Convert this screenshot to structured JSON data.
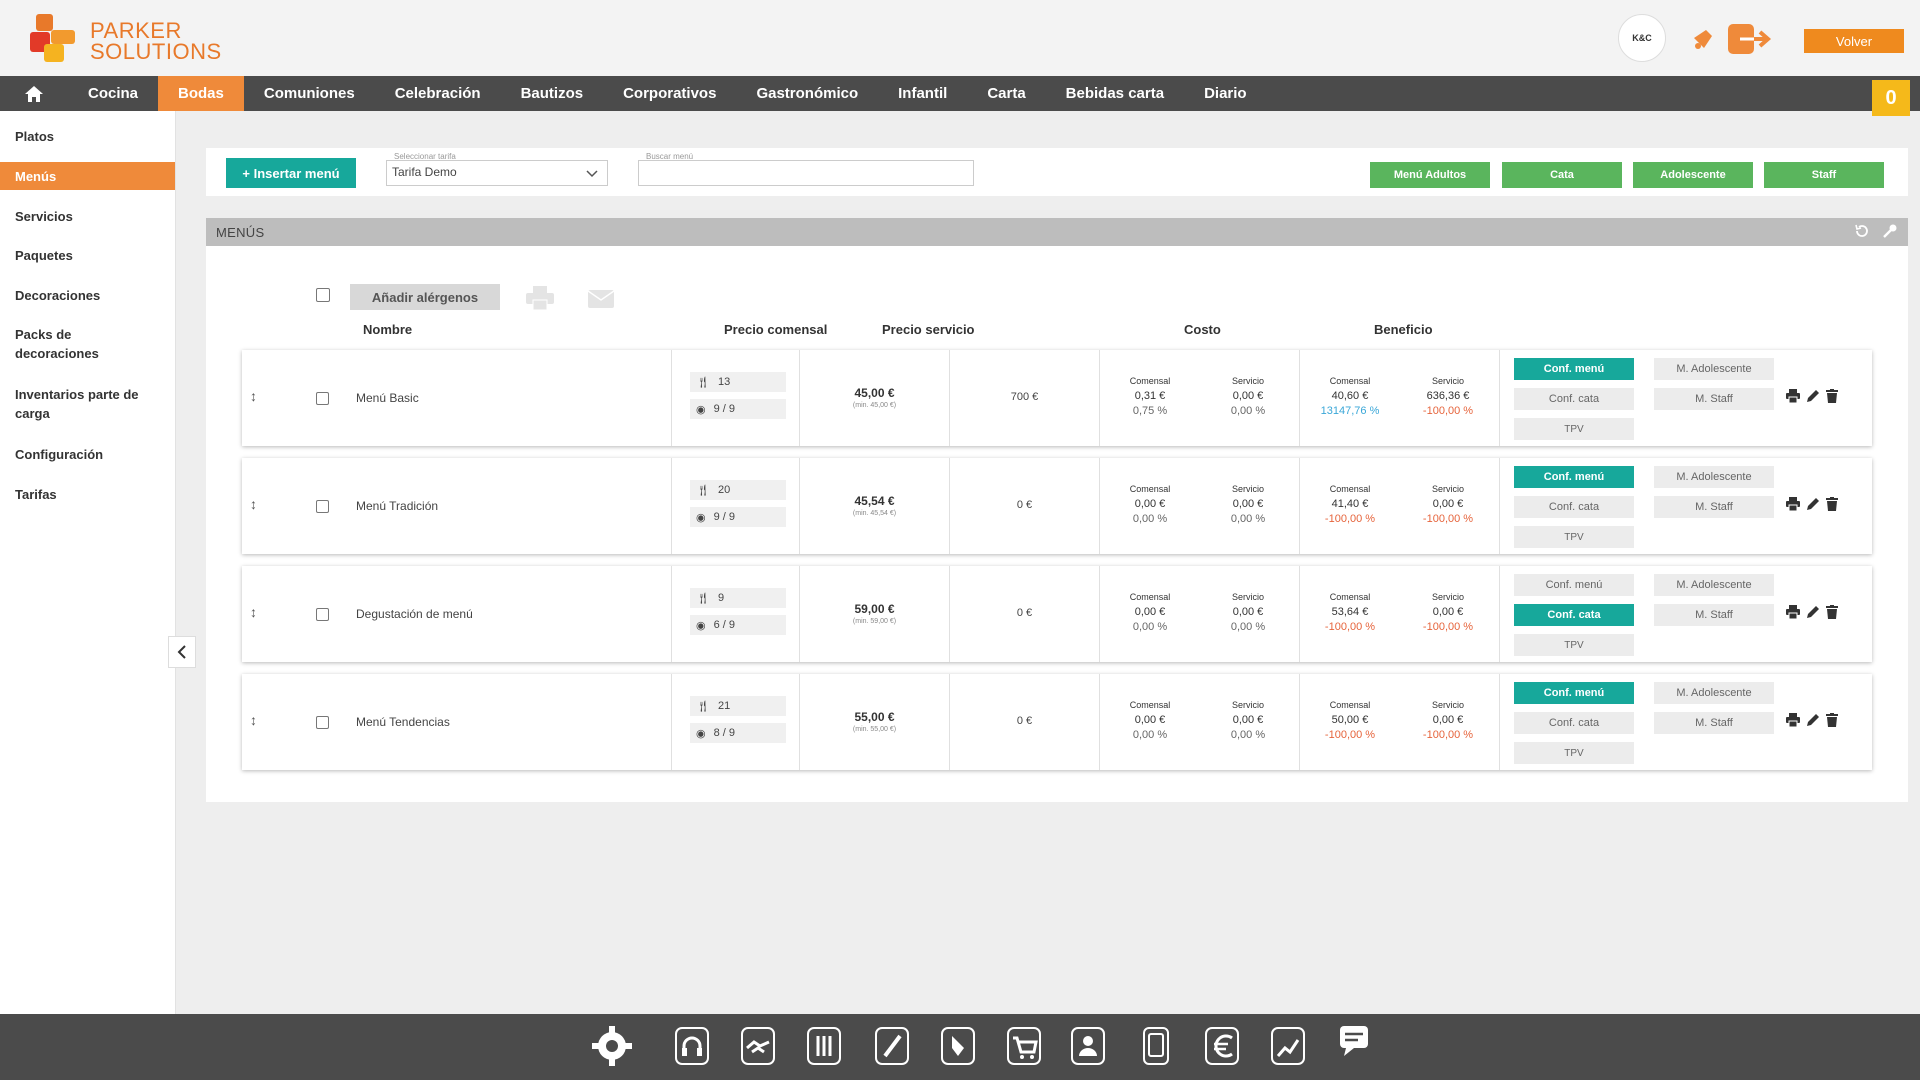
{
  "header": {
    "logo_line1": "PARKER",
    "logo_line2": "SOLUTIONS",
    "avatar_text": "K&C",
    "back_label": "Volver",
    "cart_count": "0"
  },
  "nav": {
    "items": [
      "Cocina",
      "Bodas",
      "Comuniones",
      "Celebración",
      "Bautizos",
      "Corporativos",
      "Gastronómico",
      "Infantil",
      "Carta",
      "Bebidas carta",
      "Diario"
    ],
    "active": "Bodas"
  },
  "sidebar": {
    "items": [
      "Platos",
      "Menús",
      "Servicios",
      "Paquetes",
      "Decoraciones",
      "Packs de decoraciones",
      "Inventarios parte de carga",
      "Configuración",
      "Tarifas"
    ],
    "active": "Menús"
  },
  "toolbar": {
    "insert_label": "+ Insertar menú",
    "tarifa_label": "Seleccionar tarifa",
    "tarifa_value": "Tarifa Demo",
    "search_label": "Buscar menú",
    "search_value": "",
    "filters": [
      "Menú Adultos",
      "Cata",
      "Adolescente",
      "Staff"
    ]
  },
  "panel": {
    "title": "MENÚS",
    "add_allergens_label": "Añadir alérgenos",
    "columns": {
      "name": "Nombre",
      "diner_price": "Precio comensal",
      "service_price": "Precio servicio",
      "cost": "Costo",
      "profit": "Beneficio"
    },
    "sub_labels": {
      "diner": "Comensal",
      "service": "Servicio"
    },
    "action_labels": {
      "conf_menu": "Conf. menú",
      "conf_cata": "Conf. cata",
      "tpv": "TPV",
      "m_adolescente": "M. Adolescente",
      "m_staff": "M. Staff"
    },
    "rows": [
      {
        "name": "Menú Basic",
        "dishes": "13",
        "views": "9 / 9",
        "price": "45,00 €",
        "price_min": "(min. 45,00 €)",
        "service_price": "700 €",
        "cost_diner": "0,31 €",
        "cost_diner_pct": "0,75 %",
        "cost_service": "0,00 €",
        "cost_service_pct": "0,00 %",
        "profit_diner": "40,60 €",
        "profit_diner_pct": "13147,76 %",
        "profit_service": "636,36 €",
        "profit_service_pct": "-100,00 %",
        "active": "menu"
      },
      {
        "name": "Menú Tradición",
        "dishes": "20",
        "views": "9 / 9",
        "price": "45,54 €",
        "price_min": "(min. 45,54 €)",
        "service_price": "0 €",
        "cost_diner": "0,00 €",
        "cost_diner_pct": "0,00 %",
        "cost_service": "0,00 €",
        "cost_service_pct": "0,00 %",
        "profit_diner": "41,40 €",
        "profit_diner_pct": "-100,00 %",
        "profit_service": "0,00 €",
        "profit_service_pct": "-100,00 %",
        "active": "menu"
      },
      {
        "name": "Degustación de menú",
        "dishes": "9",
        "views": "6 / 9",
        "price": "59,00 €",
        "price_min": "(min. 59,00 €)",
        "service_price": "0 €",
        "cost_diner": "0,00 €",
        "cost_diner_pct": "0,00 %",
        "cost_service": "0,00 €",
        "cost_service_pct": "0,00 %",
        "profit_diner": "53,64 €",
        "profit_diner_pct": "-100,00 %",
        "profit_service": "0,00 €",
        "profit_service_pct": "-100,00 %",
        "active": "cata"
      },
      {
        "name": "Menú Tendencias",
        "dishes": "21",
        "views": "8 / 9",
        "price": "55,00 €",
        "price_min": "(min. 55,00 €)",
        "service_price": "0 €",
        "cost_diner": "0,00 €",
        "cost_diner_pct": "0,00 %",
        "cost_service": "0,00 €",
        "cost_service_pct": "0,00 %",
        "profit_diner": "50,00 €",
        "profit_diner_pct": "-100,00 %",
        "profit_service": "0,00 €",
        "profit_service_pct": "-100,00 %",
        "active": "menu"
      }
    ]
  },
  "dock": {
    "icons": [
      "gear-icon",
      "headset-icon",
      "handshake-icon",
      "menu-book-icon",
      "pen-icon",
      "brush-icon",
      "cart-icon",
      "contacts-icon",
      "mobile-icon",
      "euro-icon",
      "chart-icon",
      "chat-icon"
    ]
  },
  "colors": {
    "accent_orange": "#ef8a3a",
    "teal": "#17a89b",
    "green": "#5ab55d",
    "dark_bar": "#4b4b4b",
    "negative": "#e6643c",
    "positive": "#3aa7d8"
  }
}
